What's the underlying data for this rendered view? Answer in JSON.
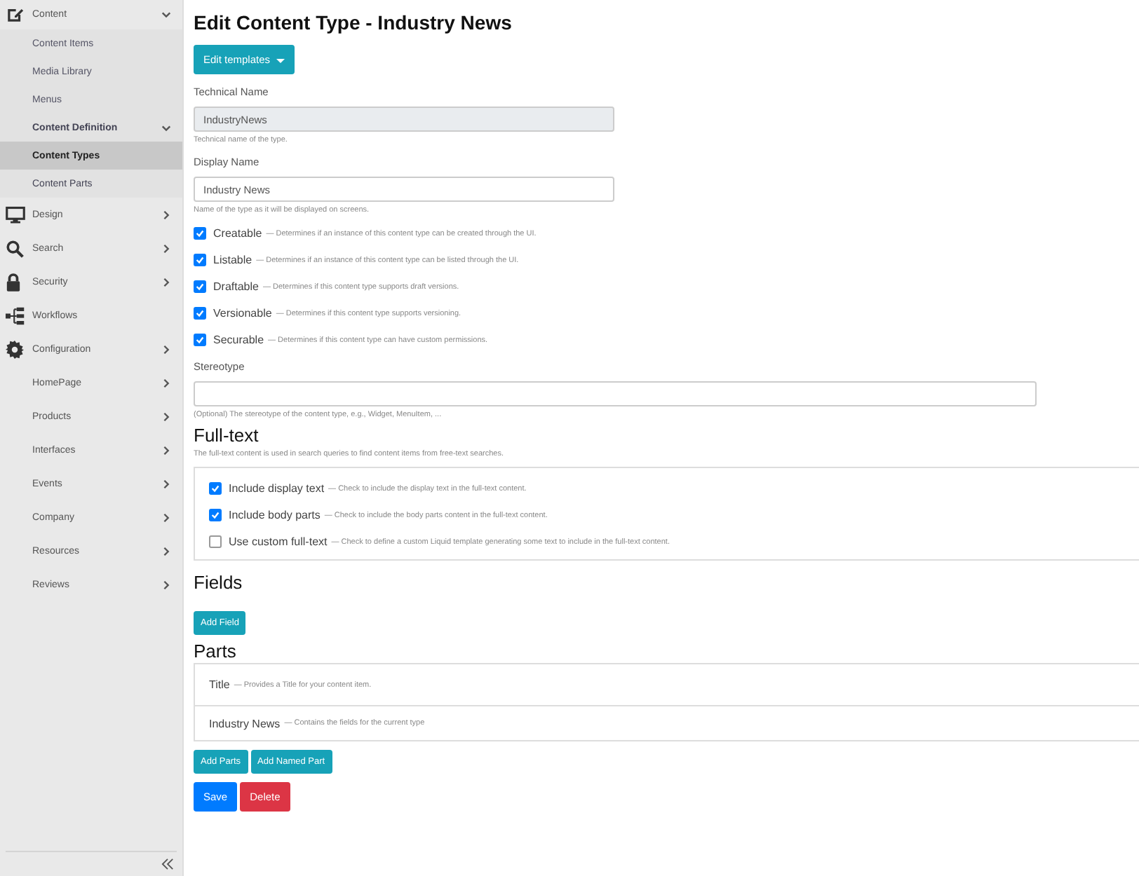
{
  "sidebar": {
    "items": [
      {
        "label": "Content",
        "expanded": true,
        "selected": false,
        "children": [
          {
            "label": "Content Items",
            "selected": false
          },
          {
            "label": "Media Library",
            "selected": false
          },
          {
            "label": "Menus",
            "selected": false
          },
          {
            "label": "Content Definition",
            "expanded": true,
            "selected": false,
            "children": [
              {
                "label": "Content Types",
                "selected": true
              },
              {
                "label": "Content Parts",
                "selected": false
              }
            ]
          }
        ]
      },
      {
        "label": "Design",
        "expanded": false,
        "selected": false
      },
      {
        "label": "Search",
        "expanded": false,
        "selected": false
      },
      {
        "label": "Security",
        "expanded": false,
        "selected": false
      },
      {
        "label": "Workflows",
        "selected": false
      },
      {
        "label": "Configuration",
        "expanded": false,
        "selected": false
      },
      {
        "label": "HomePage",
        "expanded": false,
        "selected": false
      },
      {
        "label": "Products",
        "expanded": false,
        "selected": false
      },
      {
        "label": "Interfaces",
        "expanded": false,
        "selected": false
      },
      {
        "label": "Events",
        "expanded": false,
        "selected": false
      },
      {
        "label": "Company",
        "expanded": false,
        "selected": false
      },
      {
        "label": "Resources",
        "expanded": false,
        "selected": false
      },
      {
        "label": "Reviews",
        "expanded": false,
        "selected": false
      }
    ]
  },
  "page": {
    "title": "Edit Content Type - Industry News",
    "templates_button": "Edit templates",
    "technical_name": {
      "label": "Technical Name",
      "value": "IndustryNews",
      "disabled": true,
      "hint": "Technical name of the type."
    },
    "display_name": {
      "label": "Display Name",
      "value": "Industry News",
      "disabled": false,
      "hint": "Name of the type as it will be displayed on screens."
    },
    "options": [
      {
        "label": "Creatable",
        "hint": "— Determines if an instance of this content type can be created through the UI.",
        "checked": true
      },
      {
        "label": "Listable",
        "hint": "— Determines if an instance of this content type can be listed through the UI.",
        "checked": true
      },
      {
        "label": "Draftable",
        "hint": "— Determines if this content type supports draft versions.",
        "checked": true
      },
      {
        "label": "Versionable",
        "hint": "— Determines if this content type supports versioning.",
        "checked": true
      },
      {
        "label": "Securable",
        "hint": "— Determines if this content type can have custom permissions.",
        "checked": true
      }
    ],
    "stereotype": {
      "label": "Stereotype",
      "hint": "(Optional) The stereotype of the content type, e.g., Widget, MenuItem, ..."
    },
    "full_text": {
      "heading": "Full-text",
      "description": "The full-text content is used in search queries to find content items from free-text searches.",
      "options": [
        {
          "label": "Include display text",
          "hint": "— Check to include the display text in the full-text content.",
          "checked": true
        },
        {
          "label": "Include body parts",
          "hint": "— Check to include the body parts content in the full-text content.",
          "checked": true
        },
        {
          "label": "Use custom full-text",
          "hint": "— Check to define a custom Liquid template generating some text to include in the full-text content.",
          "checked": false
        }
      ]
    },
    "fields": {
      "heading": "Fields",
      "button": "Add Field"
    },
    "parts": {
      "heading": "Parts",
      "items": [
        {
          "name": "Title",
          "description": "— Provides a Title for your content item."
        },
        {
          "name": "Industry News",
          "description": "— Contains the fields for the current type"
        }
      ],
      "buttons": [
        "Add Parts",
        "Add Named Part"
      ]
    },
    "actions": [
      {
        "label": "Save",
        "kind": "primary"
      },
      {
        "label": "Delete",
        "kind": "danger"
      }
    ]
  }
}
